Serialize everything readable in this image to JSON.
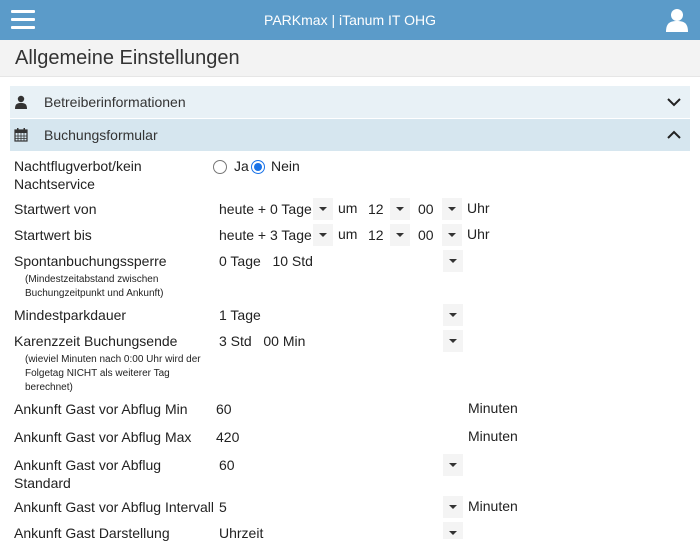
{
  "header": {
    "title": "PARKmax | iTanum IT OHG",
    "menu_icon": "hamburger-icon",
    "user_icon": "user-icon",
    "color": "#5b9bc9"
  },
  "page": {
    "title": "Allgemeine Einstellungen"
  },
  "sections": [
    {
      "label": "Betreiberinformationen",
      "icon": "user-icon",
      "state": "collapsed"
    },
    {
      "label": "Buchungsformular",
      "icon": "calendar-icon",
      "state": "expanded"
    }
  ],
  "form": {
    "nachtflug": {
      "label_line1": "Nachtflugverbot/kein",
      "label_line2": "Nachtservice",
      "opt_ja": "Ja",
      "opt_nein": "Nein",
      "selected": "Nein"
    },
    "startwert_von": {
      "label": "Startwert von",
      "days": "heute + 0 Tage",
      "um": "um",
      "hour": "12",
      "minute": "00",
      "unit": "Uhr"
    },
    "startwert_bis": {
      "label": "Startwert bis",
      "days": "heute + 3 Tage",
      "um": "um",
      "hour": "12",
      "minute": "00",
      "unit": "Uhr"
    },
    "spontan": {
      "label": "Spontanbuchungssperre",
      "note_line1": "(Mindestzeitabstand zwischen",
      "note_line2": "Buchungzeitpunkt und Ankunft)",
      "value": "0 Tage   10 Std"
    },
    "mindestparkdauer": {
      "label": "Mindestparkdauer",
      "value": "1 Tage"
    },
    "karenzzeit": {
      "label": "Karenzzeit Buchungsende",
      "note_line1": "(wieviel Minuten nach 0:00 Uhr wird der",
      "note_line2": "Folgetag NICHT als weiterer Tag",
      "note_line3": "berechnet)",
      "value": "3 Std   00 Min"
    },
    "abflug_min": {
      "label": "Ankunft Gast vor Abflug Min",
      "value": "60",
      "unit": "Minuten"
    },
    "abflug_max": {
      "label": "Ankunft Gast vor Abflug Max",
      "value": "420",
      "unit": "Minuten"
    },
    "abflug_standard": {
      "label_line1": "Ankunft Gast vor Abflug",
      "label_line2": "Standard",
      "value": "60"
    },
    "abflug_intervall": {
      "label": "Ankunft Gast vor Abflug Intervall",
      "value": "5",
      "unit": "Minuten"
    },
    "darstellung": {
      "label": "Ankunft Gast Darstellung",
      "value": "Uhrzeit"
    }
  }
}
